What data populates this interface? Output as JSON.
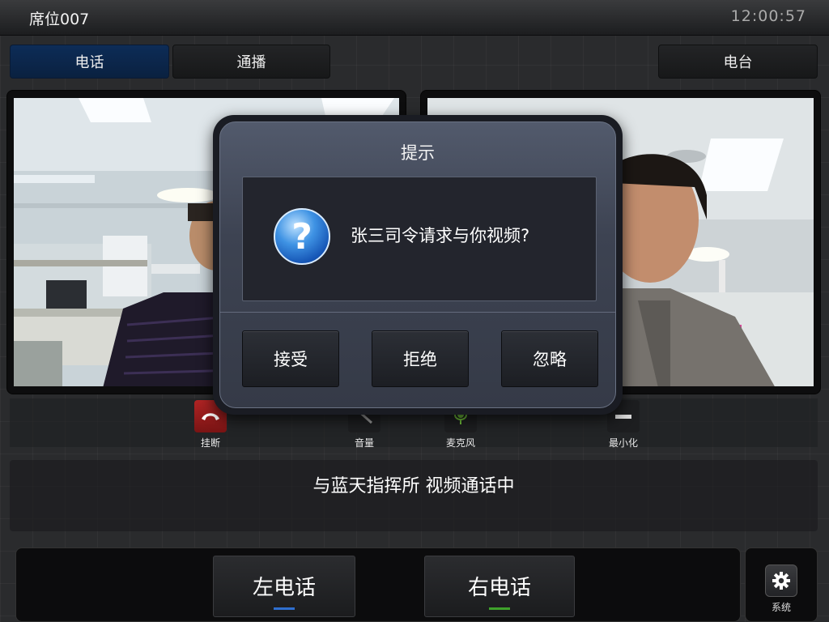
{
  "topbar": {
    "seat": "席位007",
    "time": "12:00:57"
  },
  "tabs": [
    {
      "label": "电话",
      "active": true
    },
    {
      "label": "通播",
      "active": false
    },
    {
      "label": "电台",
      "active": false
    }
  ],
  "controls": {
    "hangup": "挂断",
    "volume": "音量",
    "mic": "麦克风",
    "minimize": "最小化"
  },
  "status": {
    "text": "与蓝天指挥所 视频通话中"
  },
  "bottom": {
    "left_phone": "左电话",
    "right_phone": "右电话",
    "system": "系统"
  },
  "dialog": {
    "title": "提示",
    "message": "张三司令请求与你视频?",
    "buttons": {
      "accept": "接受",
      "reject": "拒绝",
      "ignore": "忽略"
    }
  },
  "colors": {
    "active_tab": "#0d2c57",
    "left_phone_indicator": "#2f6fd0",
    "right_phone_indicator": "#3fa22b",
    "hangup": "#9a1c1c"
  }
}
